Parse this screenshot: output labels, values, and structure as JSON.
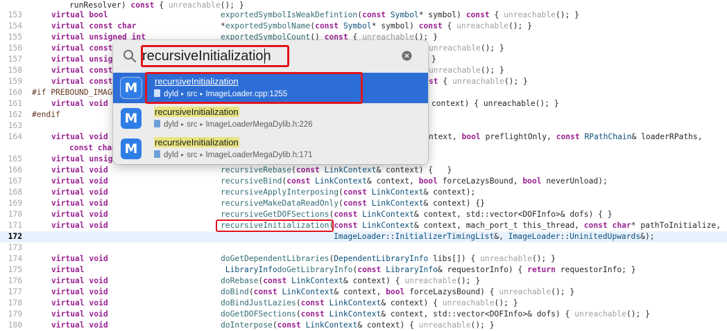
{
  "colors": {
    "keyword": "#9b2393",
    "type": "#0b4f79",
    "function": "#326d74",
    "preprocessor": "#643820",
    "unreachable": "#a1a1a1",
    "selection": "#2d6ed6",
    "current_line": "#e8f2fe",
    "annotation": "#e0141e"
  },
  "open_quickly": {
    "search_value": "recursiveInitialization",
    "results": [
      {
        "icon_letter": "M",
        "title": "recursiveInitialization",
        "crumbs": [
          "dyld",
          "src",
          "ImageLoader.cpp:1255"
        ],
        "selected": true
      },
      {
        "icon_letter": "M",
        "title": "recursiveInitialization",
        "crumbs": [
          "dyld",
          "src",
          "ImageLoaderMegaDylib.h:226"
        ],
        "selected": false
      },
      {
        "icon_letter": "M",
        "title": "recursiveInitialization",
        "crumbs": [
          "dyld",
          "src",
          "ImageLoaderMegaDylib.h:171"
        ],
        "selected": false
      }
    ]
  },
  "code_lines": [
    {
      "n": "",
      "segs": [
        {
          "t": "runResolver) ",
          "c": "pl"
        },
        {
          "t": "const",
          "c": "kw"
        },
        {
          "t": " { ",
          "c": "pl"
        },
        {
          "t": "unreachable",
          "c": "mut"
        },
        {
          "t": "(); }",
          "c": "pl"
        }
      ]
    },
    {
      "n": "153",
      "segs": [
        {
          "t": "virtual bool",
          "c": "kw"
        },
        {
          "t": "exportedSymbolIsWeakDefintion",
          "c": "fn"
        },
        {
          "t": "(",
          "c": "pl"
        },
        {
          "t": "const",
          "c": "kw"
        },
        {
          "t": " Symbol",
          "c": "ty"
        },
        {
          "t": "* symbol) ",
          "c": "pl"
        },
        {
          "t": "const",
          "c": "kw"
        },
        {
          "t": " { ",
          "c": "pl"
        },
        {
          "t": "unreachable",
          "c": "mut"
        },
        {
          "t": "(); }",
          "c": "pl"
        }
      ]
    },
    {
      "n": "154",
      "segs": [
        {
          "t": "virtual const char",
          "c": "kw"
        },
        {
          "t": "*",
          "c": "pl"
        },
        {
          "t": "exportedSymbolName",
          "c": "fn"
        },
        {
          "t": "(",
          "c": "pl"
        },
        {
          "t": "const",
          "c": "kw"
        },
        {
          "t": " Symbol",
          "c": "ty"
        },
        {
          "t": "* symbol) ",
          "c": "pl"
        },
        {
          "t": "const",
          "c": "kw"
        },
        {
          "t": " { ",
          "c": "pl"
        },
        {
          "t": "unreachable",
          "c": "mut"
        },
        {
          "t": "(); }",
          "c": "pl"
        }
      ]
    },
    {
      "n": "155",
      "segs": [
        {
          "t": "virtual unsigned int",
          "c": "kw"
        },
        {
          "t": "exportedSymbolCount",
          "c": "fn"
        },
        {
          "t": "() ",
          "c": "pl"
        },
        {
          "t": "const",
          "c": "kw"
        },
        {
          "t": " { ",
          "c": "pl"
        },
        {
          "t": "unreachable",
          "c": "mut"
        },
        {
          "t": "(); }",
          "c": "pl"
        }
      ]
    },
    {
      "n": "156",
      "segs": [
        {
          "t": "virtual const",
          "c": "kw"
        },
        {
          "t": "unreachable",
          "c": "mut"
        },
        {
          "t": "(); }",
          "c": "pl"
        }
      ]
    },
    {
      "n": "157",
      "segs": [
        {
          "t": "virtual unsign",
          "c": "kw"
        },
        {
          "t": "}",
          "c": "pl"
        }
      ]
    },
    {
      "n": "158",
      "segs": [
        {
          "t": "virtual const",
          "c": "kw"
        },
        {
          "t": "unreachable",
          "c": "mut"
        },
        {
          "t": "(); }",
          "c": "pl"
        }
      ]
    },
    {
      "n": "159",
      "segs": [
        {
          "t": "virtual const",
          "c": "kw"
        },
        {
          "t": "st",
          "c": "kw"
        },
        {
          "t": " { ",
          "c": "pl"
        },
        {
          "t": "unreachable",
          "c": "mut"
        },
        {
          "t": "(); }",
          "c": "pl"
        }
      ]
    },
    {
      "n": "160",
      "segs": [
        {
          "t": "#if PREBOUND_IMAGE",
          "c": "pre"
        }
      ]
    },
    {
      "n": "161",
      "segs": [
        {
          "t": "virtual void",
          "c": "kw"
        },
        {
          "t": "context) { unreachable(); }",
          "c": "pl"
        }
      ]
    },
    {
      "n": "162",
      "segs": [
        {
          "t": "#endif",
          "c": "pre"
        }
      ]
    },
    {
      "n": "163",
      "segs": []
    },
    {
      "n": "164",
      "segs": [
        {
          "t": "virtual void",
          "c": "kw"
        },
        {
          "t": "ntext, ",
          "c": "pl"
        },
        {
          "t": "bool",
          "c": "kw"
        },
        {
          "t": " preflightOnly, ",
          "c": "pl"
        },
        {
          "t": "const",
          "c": "kw"
        },
        {
          "t": " RPathChain",
          "c": "ty"
        },
        {
          "t": "& loaderRPaths,",
          "c": "pl"
        }
      ]
    },
    {
      "n": "",
      "segs": [
        {
          "t": "const char",
          "c": "kw"
        }
      ]
    },
    {
      "n": "165",
      "segs": [
        {
          "t": "virtual unsign",
          "c": "kw"
        }
      ]
    },
    {
      "n": "166",
      "segs": [
        {
          "t": "virtual void",
          "c": "kw"
        },
        {
          "t": "recursiveRebase",
          "c": "fn"
        },
        {
          "t": "(",
          "c": "pl"
        },
        {
          "t": "const",
          "c": "kw"
        },
        {
          "t": " LinkContext",
          "c": "ty"
        },
        {
          "t": "& context) {   }",
          "c": "pl"
        }
      ]
    },
    {
      "n": "167",
      "segs": [
        {
          "t": "virtual void",
          "c": "kw"
        },
        {
          "t": "recursiveBind",
          "c": "fn"
        },
        {
          "t": "(",
          "c": "pl"
        },
        {
          "t": "const",
          "c": "kw"
        },
        {
          "t": " LinkContext",
          "c": "ty"
        },
        {
          "t": "& context, ",
          "c": "pl"
        },
        {
          "t": "bool",
          "c": "kw"
        },
        {
          "t": " forceLazysBound, ",
          "c": "pl"
        },
        {
          "t": "bool",
          "c": "kw"
        },
        {
          "t": " neverUnload);",
          "c": "pl"
        }
      ]
    },
    {
      "n": "168",
      "segs": [
        {
          "t": "virtual void",
          "c": "kw"
        },
        {
          "t": "recursiveApplyInterposing",
          "c": "fn"
        },
        {
          "t": "(",
          "c": "pl"
        },
        {
          "t": "const",
          "c": "kw"
        },
        {
          "t": " LinkContext",
          "c": "ty"
        },
        {
          "t": "& context);",
          "c": "pl"
        }
      ]
    },
    {
      "n": "169",
      "segs": [
        {
          "t": "virtual void",
          "c": "kw"
        },
        {
          "t": "recursiveMakeDataReadOnly",
          "c": "fn"
        },
        {
          "t": "(",
          "c": "pl"
        },
        {
          "t": "const",
          "c": "kw"
        },
        {
          "t": " LinkContext",
          "c": "ty"
        },
        {
          "t": "& context) {}",
          "c": "pl"
        }
      ]
    },
    {
      "n": "170",
      "segs": [
        {
          "t": "virtual void",
          "c": "kw"
        },
        {
          "t": "recursiveGetDOFSections",
          "c": "fn"
        },
        {
          "t": "(",
          "c": "pl"
        },
        {
          "t": "const",
          "c": "kw"
        },
        {
          "t": " LinkContext",
          "c": "ty"
        },
        {
          "t": "& context, std::vector<DOFInfo>& dofs) { }",
          "c": "pl"
        }
      ]
    },
    {
      "n": "171",
      "segs": [
        {
          "t": "virtual void",
          "c": "kw"
        },
        {
          "t": "recursiveInitialization",
          "c": "fn"
        },
        {
          "t": "(",
          "c": "pl"
        },
        {
          "t": "const",
          "c": "kw"
        },
        {
          "t": " LinkContext",
          "c": "ty"
        },
        {
          "t": "& context, mach_port_t this_thread, ",
          "c": "pl"
        },
        {
          "t": "const char",
          "c": "kw"
        },
        {
          "t": "* pathToInitialize,",
          "c": "pl"
        }
      ]
    },
    {
      "n": "172",
      "segs": [
        {
          "t": "ImageLoader",
          "c": "ty"
        },
        {
          "t": "::",
          "c": "pl"
        },
        {
          "t": "InitializerTimingList",
          "c": "ty"
        },
        {
          "t": "&, ",
          "c": "pl"
        },
        {
          "t": "ImageLoader",
          "c": "ty"
        },
        {
          "t": "::",
          "c": "pl"
        },
        {
          "t": "UninitedUpwards",
          "c": "ty"
        },
        {
          "t": "&);",
          "c": "pl"
        }
      ]
    },
    {
      "n": "173",
      "segs": []
    },
    {
      "n": "174",
      "segs": [
        {
          "t": "virtual void",
          "c": "kw"
        },
        {
          "t": "doGetDependentLibraries",
          "c": "fn"
        },
        {
          "t": "(",
          "c": "pl"
        },
        {
          "t": "DependentLibraryInfo",
          "c": "ty"
        },
        {
          "t": " libs[]) { ",
          "c": "pl"
        },
        {
          "t": "unreachable",
          "c": "mut"
        },
        {
          "t": "(); }",
          "c": "pl"
        }
      ]
    },
    {
      "n": "175",
      "segs": [
        {
          "t": "virtual",
          "c": "kw"
        },
        {
          "t": " LibraryInfo",
          "c": "ty"
        },
        {
          "t": "doGetLibraryInfo",
          "c": "fn"
        },
        {
          "t": "(",
          "c": "pl"
        },
        {
          "t": "const",
          "c": "kw"
        },
        {
          "t": " LibraryInfo",
          "c": "ty"
        },
        {
          "t": "& requestorInfo) { ",
          "c": "pl"
        },
        {
          "t": "return",
          "c": "kw"
        },
        {
          "t": " requestorInfo; }",
          "c": "pl"
        }
      ]
    },
    {
      "n": "176",
      "segs": [
        {
          "t": "virtual void",
          "c": "kw"
        },
        {
          "t": "doRebase",
          "c": "fn"
        },
        {
          "t": "(",
          "c": "pl"
        },
        {
          "t": "const",
          "c": "kw"
        },
        {
          "t": " LinkContext",
          "c": "ty"
        },
        {
          "t": "& context) { ",
          "c": "pl"
        },
        {
          "t": "unreachable",
          "c": "mut"
        },
        {
          "t": "(); }",
          "c": "pl"
        }
      ]
    },
    {
      "n": "177",
      "segs": [
        {
          "t": "virtual void",
          "c": "kw"
        },
        {
          "t": "doBind",
          "c": "fn"
        },
        {
          "t": "(",
          "c": "pl"
        },
        {
          "t": "const",
          "c": "kw"
        },
        {
          "t": " LinkContext",
          "c": "ty"
        },
        {
          "t": "& context, ",
          "c": "pl"
        },
        {
          "t": "bool",
          "c": "kw"
        },
        {
          "t": " forceLazysBound) { ",
          "c": "pl"
        },
        {
          "t": "unreachable",
          "c": "mut"
        },
        {
          "t": "(); }",
          "c": "pl"
        }
      ]
    },
    {
      "n": "178",
      "segs": [
        {
          "t": "virtual void",
          "c": "kw"
        },
        {
          "t": "doBindJustLazies",
          "c": "fn"
        },
        {
          "t": "(",
          "c": "pl"
        },
        {
          "t": "const",
          "c": "kw"
        },
        {
          "t": " LinkContext",
          "c": "ty"
        },
        {
          "t": "& context) { ",
          "c": "pl"
        },
        {
          "t": "unreachable",
          "c": "mut"
        },
        {
          "t": "(); }",
          "c": "pl"
        }
      ]
    },
    {
      "n": "179",
      "segs": [
        {
          "t": "virtual void",
          "c": "kw"
        },
        {
          "t": "doGetDOFSections",
          "c": "fn"
        },
        {
          "t": "(",
          "c": "pl"
        },
        {
          "t": "const",
          "c": "kw"
        },
        {
          "t": " LinkContext",
          "c": "ty"
        },
        {
          "t": "& context, std::vector<DOFInfo>& dofs) { ",
          "c": "pl"
        },
        {
          "t": "unreachable",
          "c": "mut"
        },
        {
          "t": "(); }",
          "c": "pl"
        }
      ]
    },
    {
      "n": "180",
      "segs": [
        {
          "t": "virtual void",
          "c": "kw"
        },
        {
          "t": "doInterpose",
          "c": "fn"
        },
        {
          "t": "(",
          "c": "pl"
        },
        {
          "t": "const",
          "c": "kw"
        },
        {
          "t": " LinkContext",
          "c": "ty"
        },
        {
          "t": "& context) { ",
          "c": "pl"
        },
        {
          "t": "unreachable",
          "c": "mut"
        },
        {
          "t": "(); }",
          "c": "pl"
        }
      ]
    }
  ]
}
